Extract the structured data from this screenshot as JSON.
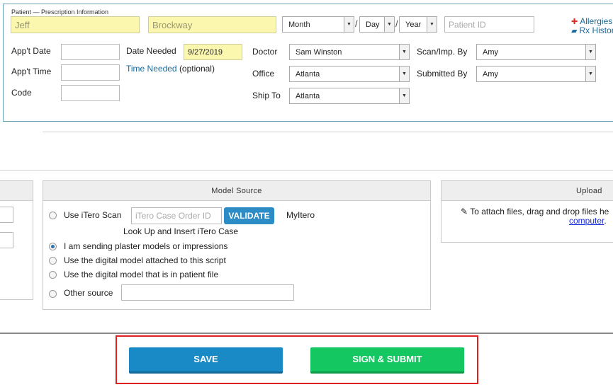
{
  "patient_box": {
    "legend": "Patient — Prescription Information",
    "first_name": "Jeff",
    "last_name": "Brockway",
    "dob_month": "Month",
    "dob_day": "Day",
    "dob_year": "Year",
    "separator": "/",
    "patient_id_placeholder": "Patient ID"
  },
  "side_links": {
    "allergies": "Allergies",
    "rx_history": "Rx History"
  },
  "appointment": {
    "appt_date_label": "App't Date",
    "appt_time_label": "App't Time",
    "code_label": "Code",
    "date_needed_label": "Date Needed",
    "date_needed_value": "9/27/2019",
    "time_needed_link": "Time Needed",
    "optional_text": "(optional)"
  },
  "assignment": {
    "doctor_label": "Doctor",
    "doctor_value": "Sam Winston",
    "office_label": "Office",
    "office_value": "Atlanta",
    "ship_to_label": "Ship To",
    "ship_to_value": "Atlanta",
    "scan_label": "Scan/Imp. By",
    "scan_value": "Amy",
    "submitted_label": "Submitted By",
    "submitted_value": "Amy"
  },
  "model_source": {
    "title": "Model Source",
    "itero_label": "Use iTero Scan",
    "itero_placeholder": "iTero Case Order ID",
    "validate_label": "VALIDATE",
    "myitero_link": "MyItero",
    "lookup_link": "Look Up and Insert iTero Case",
    "options": [
      "I am sending plaster models or impressions",
      "Use the digital model attached to this script",
      "Use the digital model that is in patient file"
    ],
    "other_label": "Other source",
    "selected_option": "I am sending plaster models or impressions"
  },
  "upload": {
    "title": "Upload",
    "instruction": "To attach files, drag and drop files he",
    "computer_link": "computer",
    "period": "."
  },
  "actions": {
    "save_label": "SAVE",
    "submit_label": "SIGN & SUBMIT"
  },
  "colors": {
    "save": "#1a8ac6",
    "submit": "#14c760",
    "highlight": "#e02020",
    "input_highlight": "#fbf7ae"
  }
}
